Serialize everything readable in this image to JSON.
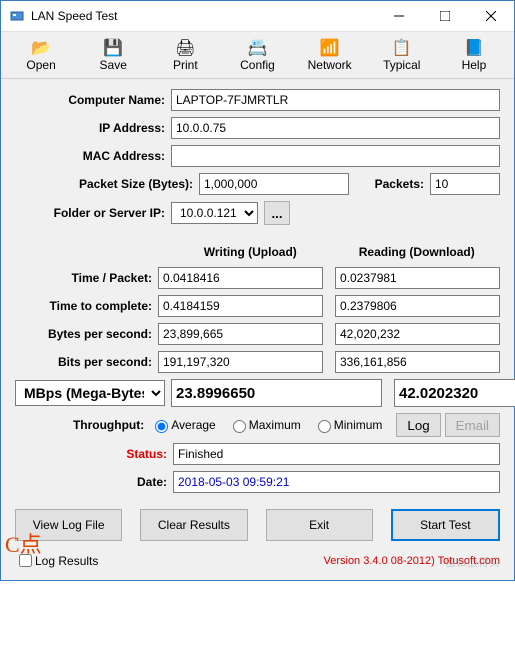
{
  "window_title": "LAN Speed Test",
  "toolbar": [
    {
      "label": "Open",
      "icon": "📂"
    },
    {
      "label": "Save",
      "icon": "💾"
    },
    {
      "label": "Print",
      "icon": "🖨"
    },
    {
      "label": "Config",
      "icon": "📇"
    },
    {
      "label": "Network",
      "icon": "📶"
    },
    {
      "label": "Typical",
      "icon": "📋"
    },
    {
      "label": "Help",
      "icon": "📘"
    }
  ],
  "labels": {
    "computer_name": "Computer Name:",
    "ip_address": "IP Address:",
    "mac_address": "MAC Address:",
    "packet_size": "Packet Size (Bytes):",
    "packets": "Packets:",
    "folder": "Folder or Server IP:",
    "writing": "Writing (Upload)",
    "reading": "Reading (Download)",
    "time_packet": "Time / Packet:",
    "time_complete": "Time to complete:",
    "bytes_sec": "Bytes per second:",
    "bits_sec": "Bits per second:",
    "unit": "MBps (Mega-Bytes)",
    "throughput": "Throughput:",
    "avg": "Average",
    "max": "Maximum",
    "min": "Minimum",
    "log": "Log",
    "email": "Email",
    "status": "Status:",
    "date": "Date:",
    "view_log": "View Log File",
    "clear": "Clear Results",
    "exit": "Exit",
    "start": "Start Test",
    "log_results": "Log Results",
    "browse": "..."
  },
  "fields": {
    "computer_name": "LAPTOP-7FJMRTLR",
    "ip_address": "10.0.0.75",
    "mac_address": "",
    "packet_size": "1,000,000",
    "packets": "10",
    "folder": "10.0.0.121"
  },
  "results": {
    "time_packet_w": "0.0418416",
    "time_packet_r": "0.0237981",
    "time_complete_w": "0.4184159",
    "time_complete_r": "0.2379806",
    "bytes_sec_w": "23,899,665",
    "bytes_sec_r": "42,020,232",
    "bits_sec_w": "191,197,320",
    "bits_sec_r": "336,161,856",
    "mbps_w": "23.8996650",
    "mbps_r": "42.0202320",
    "status": "Finished",
    "date": "2018-05-03 09:59:21"
  },
  "annotation": "C点",
  "version": "Version 3.4.0     08-2012) Totusoft.com",
  "watermark": "值么值得买"
}
